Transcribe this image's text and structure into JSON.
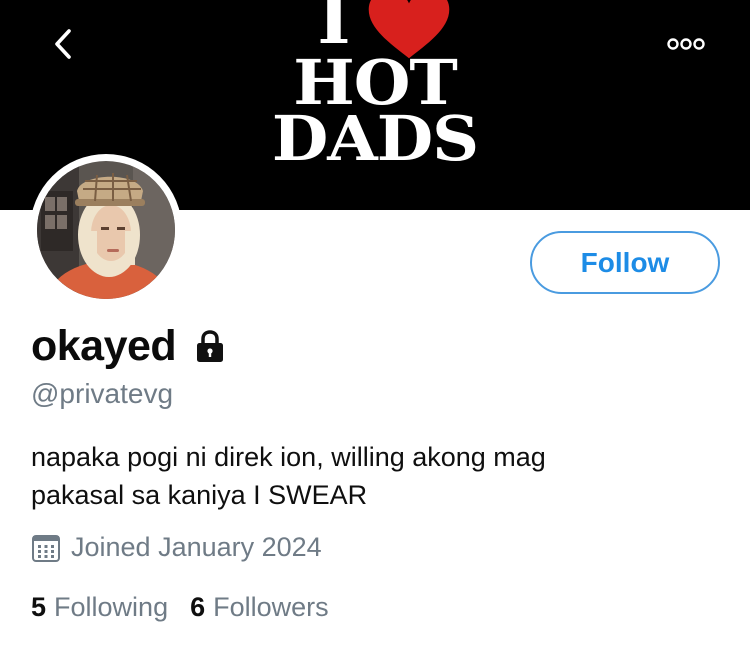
{
  "banner": {
    "line_i": "I",
    "line_1": "HOT",
    "line_2": "DADS",
    "heart_color": "#d8201d",
    "background": "#000000"
  },
  "nav": {
    "back_icon": "chevron-left-icon",
    "more_icon": "more-horizontal-icon"
  },
  "profile": {
    "display_name": "okayed",
    "handle": "@privatevg",
    "protected_icon": "lock-icon",
    "bio_lines": [
      "napaka pogi ni direk ion, willing akong mag",
      "pakasal sa kaniya I SWEAR"
    ],
    "joined_icon": "calendar-icon",
    "joined": "Joined January 2024"
  },
  "actions": {
    "follow_label": "Follow",
    "accent_color": "#1d8ce6"
  },
  "stats": {
    "following_count": "5",
    "following_label": "Following",
    "followers_count": "6",
    "followers_label": "Followers"
  }
}
